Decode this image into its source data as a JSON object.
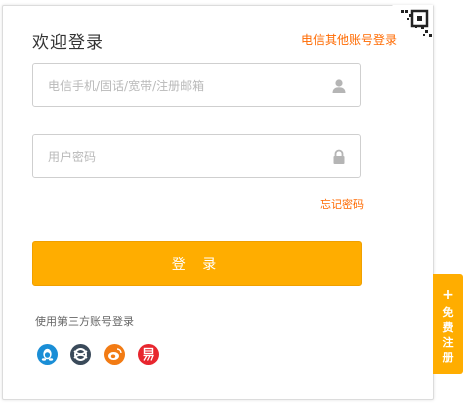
{
  "header": {
    "title": "欢迎登录",
    "other_login_link": "电信其他账号登录"
  },
  "form": {
    "account": {
      "placeholder": "电信手机/固话/宽带/注册邮箱",
      "value": "",
      "icon": "user-icon"
    },
    "password": {
      "placeholder": "用户密码",
      "value": "",
      "icon": "lock-icon"
    },
    "forgot_link": "忘记密码",
    "login_button": "登 录"
  },
  "third_party": {
    "label": "使用第三方账号登录",
    "providers": [
      {
        "name": "qq-icon",
        "color": "#1a8ed6"
      },
      {
        "name": "tianyi-icon",
        "color": "#3a4a5a"
      },
      {
        "name": "weibo-icon",
        "color": "#f27b14"
      },
      {
        "name": "yi-icon",
        "color": "#e8262e"
      }
    ]
  },
  "register_tab": {
    "plus": "+",
    "label": "免费注册"
  },
  "colors": {
    "accent": "#ffad00",
    "link": "#ff6a00"
  }
}
